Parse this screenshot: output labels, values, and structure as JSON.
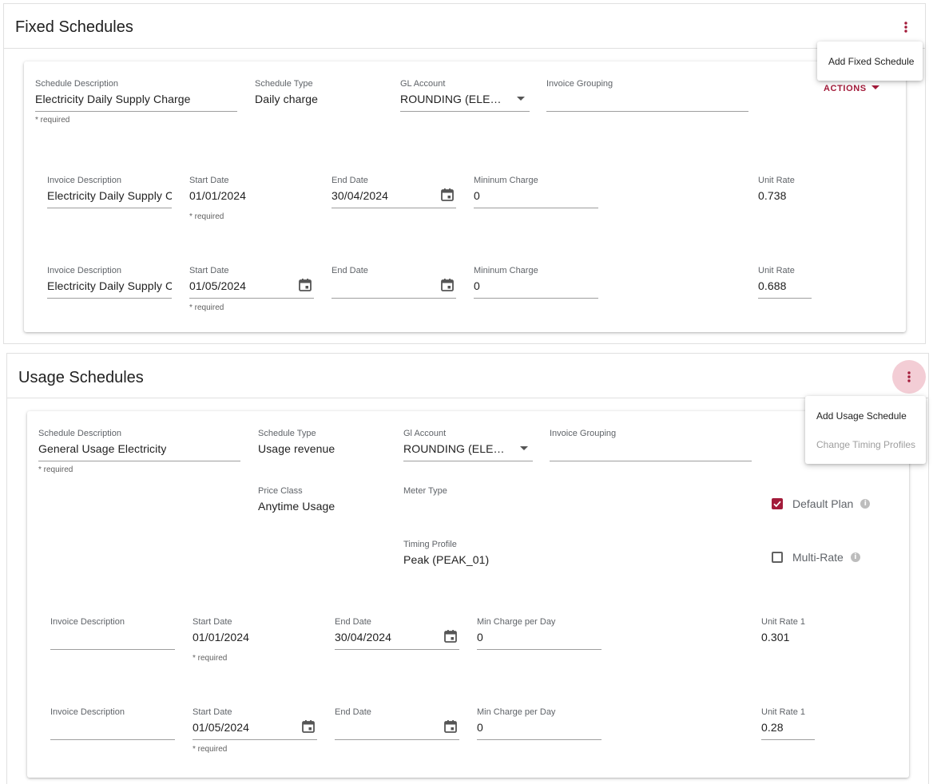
{
  "fixed": {
    "title": "Fixed Schedules",
    "menu": {
      "items": [
        "Add Fixed Schedule"
      ]
    },
    "actions_label": "ACTIONS",
    "schedule": {
      "schedule_description": {
        "label": "Schedule Description",
        "value": "Electricity Daily Supply Charge",
        "hint": "* required"
      },
      "schedule_type": {
        "label": "Schedule Type",
        "value": "Daily charge"
      },
      "gl_account": {
        "label": "GL Account",
        "value": "ROUNDING (ELE…"
      },
      "invoice_grouping": {
        "label": "Invoice Grouping",
        "value": ""
      }
    },
    "rates": [
      {
        "invoice_description": {
          "label": "Invoice Description",
          "value": "Electricity Daily Supply C"
        },
        "start_date": {
          "label": "Start Date",
          "value": "01/01/2024",
          "hint": "* required"
        },
        "end_date": {
          "label": "End Date",
          "value": "30/04/2024"
        },
        "min_charge": {
          "label": "Mininum Charge",
          "value": "0"
        },
        "unit_rate": {
          "label": "Unit Rate",
          "value": "0.738"
        }
      },
      {
        "invoice_description": {
          "label": "Invoice Description",
          "value": "Electricity Daily Supply C"
        },
        "start_date": {
          "label": "Start Date",
          "value": "01/05/2024",
          "hint": "* required"
        },
        "end_date": {
          "label": "End Date",
          "value": ""
        },
        "min_charge": {
          "label": "Mininum Charge",
          "value": "0"
        },
        "unit_rate": {
          "label": "Unit Rate",
          "value": "0.688"
        }
      }
    ]
  },
  "usage": {
    "title": "Usage Schedules",
    "menu": {
      "items": [
        "Add Usage Schedule",
        "Change Timing Profiles"
      ]
    },
    "schedule": {
      "schedule_description": {
        "label": "Schedule Description",
        "value": "General Usage Electricity",
        "hint": "* required"
      },
      "schedule_type": {
        "label": "Schedule Type",
        "value": "Usage revenue"
      },
      "gl_account": {
        "label": "Gl Account",
        "value": "ROUNDING (ELE…"
      },
      "invoice_grouping": {
        "label": "Invoice Grouping",
        "value": ""
      },
      "price_class": {
        "label": "Price Class",
        "value": "Anytime Usage"
      },
      "meter_type": {
        "label": "Meter Type",
        "value": ""
      },
      "timing_profile": {
        "label": "Timing Profile",
        "value": "Peak (PEAK_01)"
      },
      "default_plan": {
        "label": "Default Plan",
        "checked": true
      },
      "multi_rate": {
        "label": "Multi-Rate",
        "checked": false
      }
    },
    "rates": [
      {
        "invoice_description": {
          "label": "Invoice Description",
          "value": ""
        },
        "start_date": {
          "label": "Start Date",
          "value": "01/01/2024",
          "hint": "* required"
        },
        "end_date": {
          "label": "End Date",
          "value": "30/04/2024"
        },
        "min_charge": {
          "label": "Min Charge per Day",
          "value": "0"
        },
        "unit_rate": {
          "label": "Unit Rate 1",
          "value": "0.301"
        }
      },
      {
        "invoice_description": {
          "label": "Invoice Description",
          "value": ""
        },
        "start_date": {
          "label": "Start Date",
          "value": "01/05/2024",
          "hint": "* required"
        },
        "end_date": {
          "label": "End Date",
          "value": ""
        },
        "min_charge": {
          "label": "Min Charge per Day",
          "value": "0"
        },
        "unit_rate": {
          "label": "Unit Rate 1",
          "value": "0.28"
        }
      }
    ]
  },
  "colors": {
    "accent": "#a31b3a",
    "accent_light": "#f3cdd5",
    "divider": "#e0e0e0",
    "underline": "#9e9e9e"
  },
  "icons": {
    "kebab": "more-vert-icon",
    "calendar": "calendar-icon",
    "dropdown": "dropdown-arrow-icon",
    "info": "info-icon",
    "check": "check-icon"
  }
}
